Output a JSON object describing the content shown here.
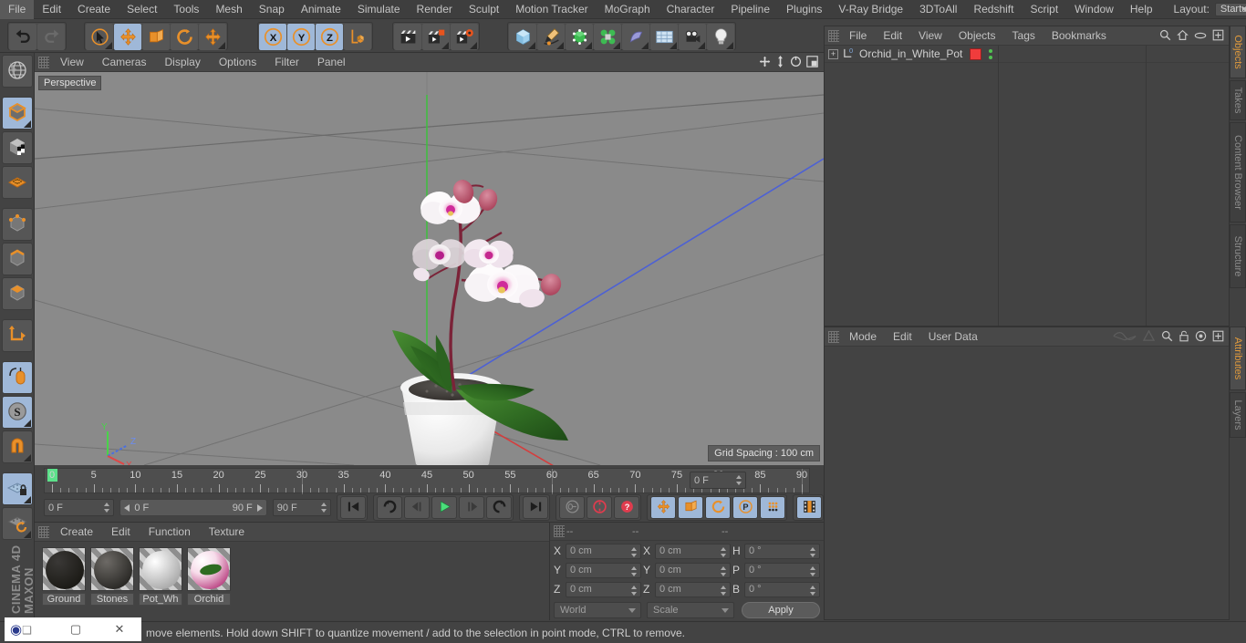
{
  "app": {
    "title": "CINEMA 4D",
    "brand": "MAXON"
  },
  "menubar": {
    "items": [
      "File",
      "Edit",
      "Create",
      "Select",
      "Tools",
      "Mesh",
      "Snap",
      "Animate",
      "Simulate",
      "Render",
      "Sculpt",
      "Motion Tracker",
      "MoGraph",
      "Character",
      "Pipeline",
      "Plugins",
      "V-Ray Bridge",
      "3DToAll",
      "Redshift",
      "Script",
      "Window",
      "Help"
    ],
    "layout_label": "Layout:",
    "layout_value": "Startup",
    "search_icon": "search-icon"
  },
  "toolbar": {
    "groups": [
      {
        "name": "history",
        "buttons": [
          {
            "name": "undo-button",
            "icon": "undo-icon",
            "selected": false
          },
          {
            "name": "redo-button",
            "icon": "redo-icon",
            "selected": false
          }
        ]
      },
      {
        "name": "transform",
        "buttons": [
          {
            "name": "select-tool-button",
            "icon": "cursor-select-icon",
            "selected": false
          },
          {
            "name": "move-tool-button",
            "icon": "move-arrows-icon",
            "selected": true
          },
          {
            "name": "scale-tool-button",
            "icon": "scale-box-icon",
            "selected": false
          },
          {
            "name": "rotate-tool-button",
            "icon": "rotate-circle-icon",
            "selected": false
          },
          {
            "name": "dynamic-place-button",
            "icon": "move-arrows-icon",
            "selected": false
          }
        ]
      },
      {
        "name": "axis-locks",
        "buttons": [
          {
            "name": "lock-x-button",
            "icon": "letter-x-icon",
            "selected": true
          },
          {
            "name": "lock-y-button",
            "icon": "letter-y-icon",
            "selected": true
          },
          {
            "name": "lock-z-button",
            "icon": "letter-z-icon",
            "selected": true
          },
          {
            "name": "world-object-axis-button",
            "icon": "axis-cube-icon",
            "selected": false
          }
        ]
      },
      {
        "name": "render",
        "buttons": [
          {
            "name": "render-view-button",
            "icon": "clapper-icon",
            "selected": false
          },
          {
            "name": "render-to-picture-viewer-button",
            "icon": "clapper-render-icon",
            "selected": false
          },
          {
            "name": "render-settings-button",
            "icon": "clapper-gear-icon",
            "selected": false
          }
        ]
      },
      {
        "name": "objects",
        "buttons": [
          {
            "name": "add-cube-button",
            "icon": "cube-icon",
            "selected": false
          },
          {
            "name": "add-spline-button",
            "icon": "pen-spline-icon",
            "selected": false
          },
          {
            "name": "add-nurbs-button",
            "icon": "green-cube-icon",
            "selected": false
          },
          {
            "name": "add-mograph-button",
            "icon": "cloner-icon",
            "selected": false
          },
          {
            "name": "add-deformer-button",
            "icon": "bend-deformer-icon",
            "selected": false
          },
          {
            "name": "add-scene-object-button",
            "icon": "floor-grid-icon",
            "selected": false
          },
          {
            "name": "add-camera-button",
            "icon": "camera-icon",
            "selected": false
          },
          {
            "name": "add-light-button",
            "icon": "light-bulb-icon",
            "selected": false
          }
        ]
      }
    ]
  },
  "left_toolbar": {
    "buttons": [
      {
        "name": "make-editable-button",
        "icon": "globe-wire-icon",
        "selected": false
      },
      {
        "name": "model-mode-button",
        "icon": "model-cube-icon",
        "selected": true
      },
      {
        "name": "texture-mode-button",
        "icon": "texture-checker-cube-icon",
        "selected": false
      },
      {
        "name": "uv-mesh-button",
        "icon": "uv-grid-icon",
        "selected": false
      },
      {
        "name": "points-mode-button",
        "icon": "points-cube-icon",
        "selected": false
      },
      {
        "name": "edges-mode-button",
        "icon": "edges-cube-icon",
        "selected": false
      },
      {
        "name": "polygons-mode-button",
        "icon": "polygons-cube-icon",
        "selected": false
      },
      {
        "name": "axis-modify-button",
        "icon": "axis-l-icon",
        "selected": false
      },
      {
        "name": "enable-snapping-button",
        "icon": "mouse-snap-icon",
        "selected": true
      },
      {
        "name": "soft-selection-button",
        "icon": "s-sphere-icon",
        "selected": true
      },
      {
        "name": "magnet-button",
        "icon": "magnet-icon",
        "selected": false
      },
      {
        "name": "workplane-lock-button",
        "icon": "grid-lock-icon",
        "selected": true
      },
      {
        "name": "workplane-reset-button",
        "icon": "grid-rotate-icon",
        "selected": false
      }
    ]
  },
  "viewport": {
    "menu": [
      "View",
      "Cameras",
      "Display",
      "Options",
      "Filter",
      "Panel"
    ],
    "label": "Perspective",
    "grid_spacing": "Grid Spacing : 100 cm",
    "nav_icons": [
      "pan-icon",
      "dolly-icon",
      "orbit-icon",
      "maximize-icon"
    ],
    "axis_gizmo": {
      "x": "X",
      "y": "Y",
      "z": "Z",
      "x_color": "#e04646",
      "y_color": "#4ad24a",
      "z_color": "#4a6fe0"
    },
    "scene": {
      "object": "Orchid in white pot",
      "pot_color": "#ededed",
      "soil_color": "#4a4745",
      "leaf_color": "#2f6a22",
      "stem_color": "#7b2338",
      "petal_color": "#f7f1f4",
      "petal_center_color": "#cf2a9a",
      "bud_color": "#c0607b",
      "background_color": "#8a8a8a"
    }
  },
  "timeline": {
    "tick_labels": [
      "0",
      "5",
      "10",
      "15",
      "20",
      "25",
      "30",
      "35",
      "40",
      "45",
      "50",
      "55",
      "60",
      "65",
      "70",
      "75",
      "80",
      "85",
      "90"
    ],
    "current_frame": "0 F",
    "range_start": "0 F",
    "range_end": "90 F",
    "max_frame": "90 F",
    "end_frame_field": "0 F",
    "controls": [
      {
        "name": "go-to-start-button",
        "icon": "skip-start-icon",
        "selected": false
      },
      {
        "name": "play-reverse-loop-button",
        "icon": "loop-reverse-icon",
        "selected": false
      },
      {
        "name": "step-back-button",
        "icon": "step-back-icon",
        "selected": false
      },
      {
        "name": "play-button",
        "icon": "play-icon",
        "selected": false
      },
      {
        "name": "step-forward-button",
        "icon": "step-forward-icon",
        "selected": false
      },
      {
        "name": "play-forward-loop-button",
        "icon": "loop-forward-icon",
        "selected": false
      },
      {
        "name": "go-to-end-button",
        "icon": "skip-end-icon",
        "selected": false
      }
    ],
    "record_controls": [
      {
        "name": "record-active-objects-button",
        "icon": "key-icon",
        "selected": false
      },
      {
        "name": "autokeying-button",
        "icon": "record-circle-icon",
        "selected": false
      },
      {
        "name": "keyframe-selection-button",
        "icon": "question-circle-icon",
        "selected": false
      }
    ],
    "key_toggles": [
      {
        "name": "position-key-button",
        "icon": "move-arrows-icon",
        "selected": true
      },
      {
        "name": "scale-key-button",
        "icon": "scale-box-icon",
        "selected": true
      },
      {
        "name": "rotation-key-button",
        "icon": "rotate-circle-icon",
        "selected": true
      },
      {
        "name": "param-key-button",
        "icon": "letter-p-icon",
        "selected": true
      },
      {
        "name": "point-level-animation-button",
        "icon": "dots-grid-icon",
        "selected": true
      }
    ],
    "timeline_toggle": {
      "name": "timeline-button",
      "icon": "filmstrip-icon",
      "selected": true
    }
  },
  "materials": {
    "menu": [
      "Create",
      "Edit",
      "Function",
      "Texture"
    ],
    "items": [
      {
        "name": "Ground",
        "color1": "#3a3836",
        "color2": "#15140f"
      },
      {
        "name": "Stones",
        "color1": "#6d6a66",
        "color2": "#1d1c19"
      },
      {
        "name": "Pot_Wh",
        "color1": "#ffffff",
        "color2": "#9a9a9a"
      },
      {
        "name": "Orchid",
        "color1": "#f2d2e0",
        "color2": "#9b3f72"
      }
    ]
  },
  "coordinates": {
    "header": [
      "--",
      "--",
      "--"
    ],
    "rows": [
      {
        "label1": "X",
        "value1": "0 cm",
        "label2": "X",
        "value2": "0 cm",
        "label3": "H",
        "value3": "0 °"
      },
      {
        "label1": "Y",
        "value1": "0 cm",
        "label2": "Y",
        "value2": "0 cm",
        "label3": "P",
        "value3": "0 °"
      },
      {
        "label1": "Z",
        "value1": "0 cm",
        "label2": "Z",
        "value2": "0 cm",
        "label3": "B",
        "value3": "0 °"
      }
    ],
    "space_dropdown": "World",
    "mode_dropdown": "Scale",
    "apply_button": "Apply"
  },
  "object_manager": {
    "menu": [
      "File",
      "Edit",
      "View",
      "Objects",
      "Tags",
      "Bookmarks"
    ],
    "tools": [
      "search-icon",
      "home-icon",
      "ellipse-icon",
      "plus-box-icon"
    ],
    "object_name": "Orchid_in_White_Pot",
    "object_layer": "0",
    "tag_color": "#f03c3c"
  },
  "attributes": {
    "menu": [
      "Mode",
      "Edit",
      "User Data"
    ],
    "tools": [
      "wave-icon",
      "cone-icon",
      "search-icon",
      "lock-icon",
      "target-icon",
      "plus-box-icon"
    ]
  },
  "side_tabs_top": [
    {
      "label": "Objects",
      "active": true
    },
    {
      "label": "Takes",
      "active": false
    },
    {
      "label": "Content Browser",
      "active": false
    },
    {
      "label": "Structure",
      "active": false
    }
  ],
  "side_tabs_bottom": [
    {
      "label": "Attributes",
      "active": true
    },
    {
      "label": "Layers",
      "active": false
    }
  ],
  "status_bar": {
    "message": "move elements. Hold down SHIFT to quantize movement / add to the selection in point mode, CTRL to remove."
  },
  "window_controls": [
    {
      "name": "app-icon",
      "glyph": "◕"
    },
    {
      "name": "restore-window-button",
      "glyph": "❐"
    },
    {
      "name": "maximize-window-button",
      "glyph": "▢"
    },
    {
      "name": "close-window-button",
      "glyph": "✕"
    }
  ]
}
